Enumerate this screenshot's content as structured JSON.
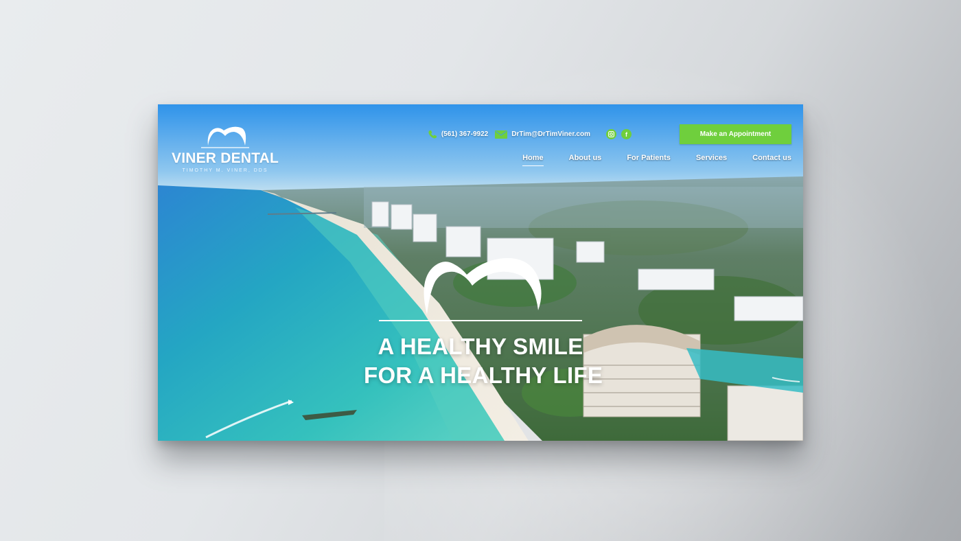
{
  "brand": {
    "name": "VINER DENTAL",
    "subtitle": "TIMOTHY M. VINER, DDS"
  },
  "contact": {
    "phone": "(561) 367-9922",
    "email": "DrTim@DrTimViner.com"
  },
  "social": {
    "instagram_icon": "instagram-icon",
    "facebook_label": "f"
  },
  "cta": {
    "appointment_label": "Make an Appointment"
  },
  "nav": {
    "items": [
      {
        "label": "Home",
        "active": true
      },
      {
        "label": "About us"
      },
      {
        "label": "For Patients"
      },
      {
        "label": "Services"
      },
      {
        "label": "Contact us"
      }
    ]
  },
  "hero": {
    "line1": "A HEALTHY SMILE",
    "line2": "FOR A HEALTHY LIFE"
  },
  "colors": {
    "accent_green": "#6fcf3d",
    "sky": "#3f9be6",
    "sea": "#2fb3b8"
  }
}
